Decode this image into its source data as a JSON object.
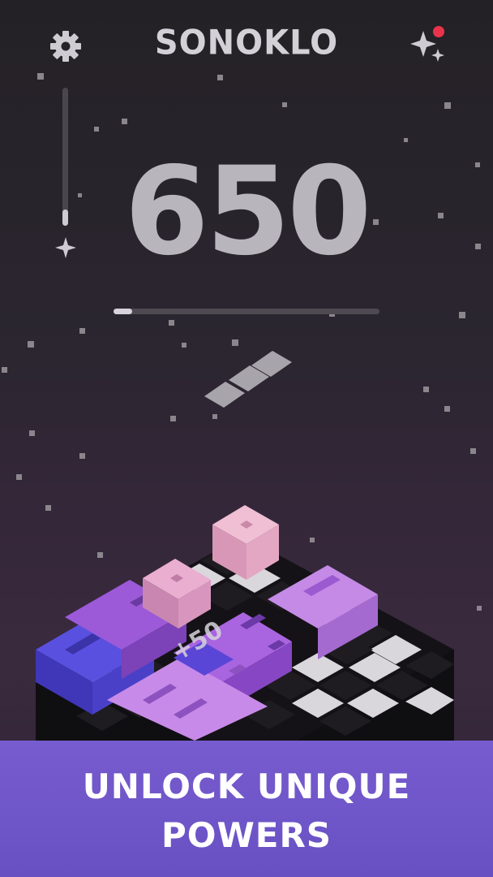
{
  "header": {
    "title": "SONOKLO",
    "settings_icon": "gear-icon",
    "powers_icon": "sparkles-icon",
    "notification_color": "#e8344b"
  },
  "power_meter": {
    "level_fraction": 0.12,
    "icon": "sparkle-icon"
  },
  "score": {
    "value": "650",
    "progress_fraction": 0.07
  },
  "board": {
    "bonus_text": "+50",
    "colors": {
      "pink_block": "#e8a9c6",
      "purple_block": "#b56fe0",
      "blue_block": "#5046d6",
      "tile_light": "#d9d6dc",
      "tile_dark": "#1e1c21"
    }
  },
  "banner": {
    "line1": "UNLOCK UNIQUE",
    "line2": "POWERS",
    "color": "#7a5fd6"
  }
}
